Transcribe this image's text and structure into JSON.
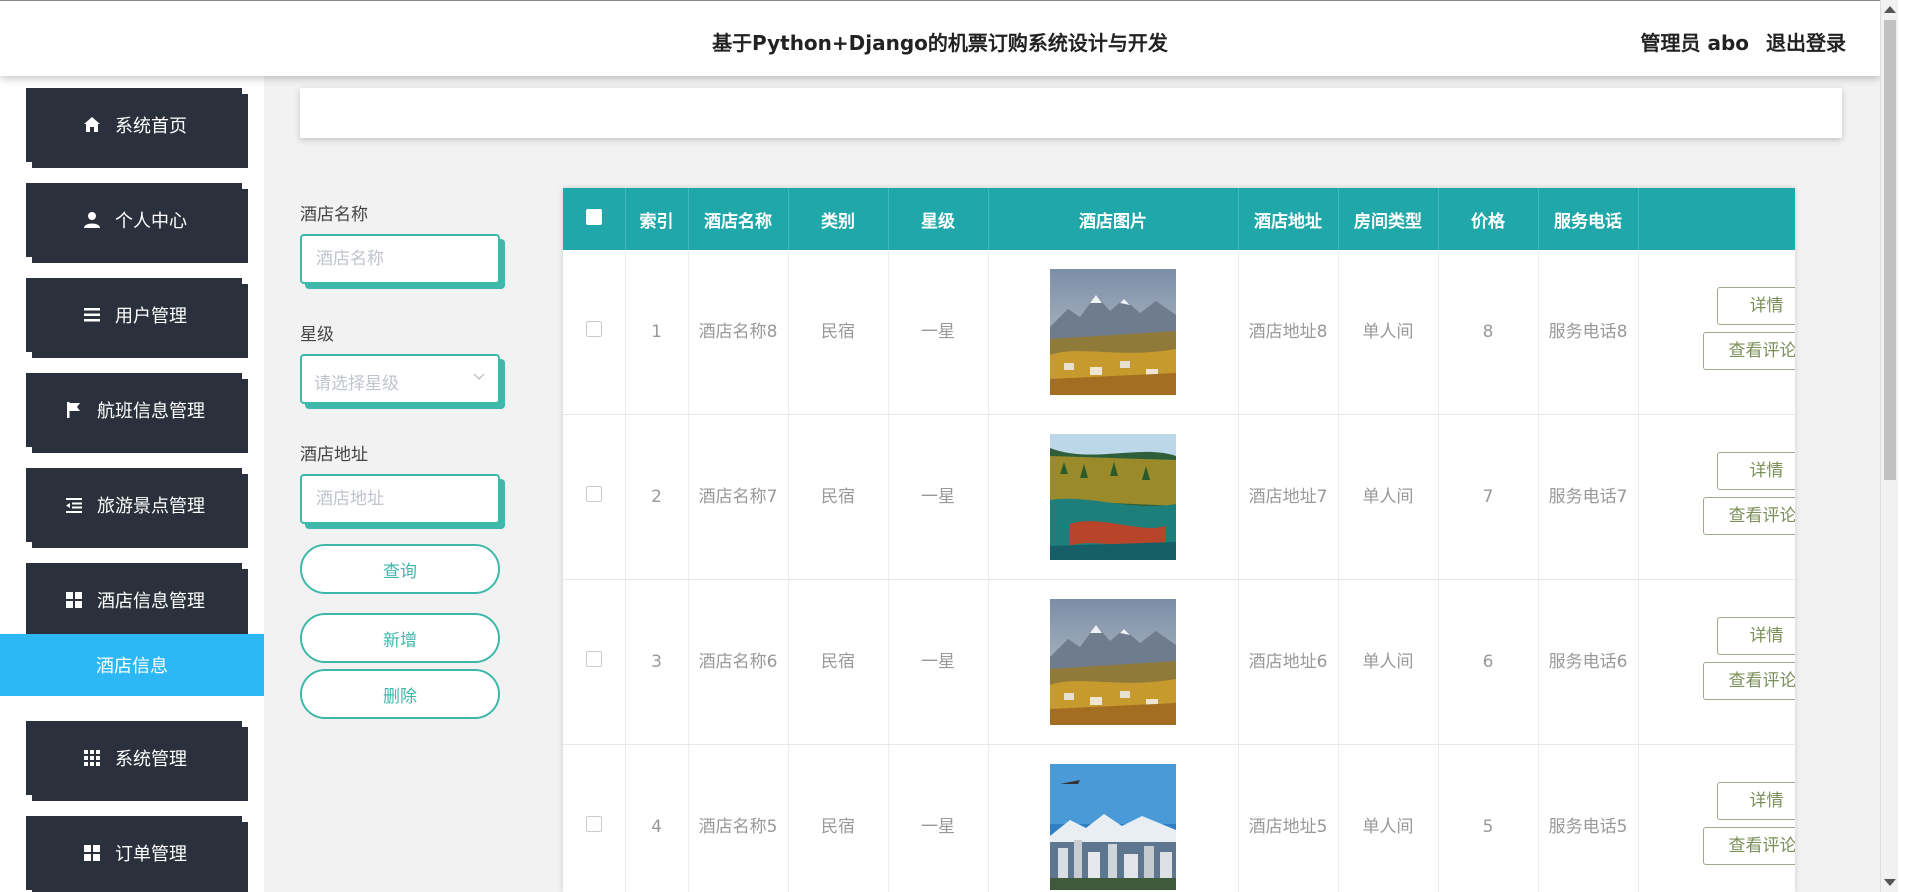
{
  "header": {
    "title": "基于Python+Django的机票订购系统设计与开发",
    "user": "管理员 abo",
    "logout": "退出登录"
  },
  "sidebar": {
    "items": [
      {
        "label": "系统首页",
        "icon": "home-icon"
      },
      {
        "label": "个人中心",
        "icon": "user-icon"
      },
      {
        "label": "用户管理",
        "icon": "list-icon"
      },
      {
        "label": "航班信息管理",
        "icon": "flag-icon"
      },
      {
        "label": "旅游景点管理",
        "icon": "indent-icon"
      },
      {
        "label": "酒店信息管理",
        "icon": "grid-icon"
      },
      {
        "label": "系统管理",
        "icon": "apps-icon"
      },
      {
        "label": "订单管理",
        "icon": "grid-icon"
      }
    ],
    "active_sub": "酒店信息"
  },
  "search": {
    "name_label": "酒店名称",
    "name_placeholder": "酒店名称",
    "star_label": "星级",
    "star_placeholder": "请选择星级",
    "addr_label": "酒店地址",
    "addr_placeholder": "酒店地址",
    "query": "查询",
    "add": "新增",
    "delete": "删除"
  },
  "table": {
    "columns": [
      "索引",
      "酒店名称",
      "类别",
      "星级",
      "酒店图片",
      "酒店地址",
      "房间类型",
      "价格",
      "服务电话"
    ],
    "detail_label": "详情",
    "review_label": "查看评论",
    "rows": [
      {
        "index": "1",
        "name": "酒店名称8",
        "type": "民宿",
        "star": "一星",
        "img": "mountain-village",
        "addr": "酒店地址8",
        "room": "单人间",
        "price": "8",
        "phone": "服务电话8"
      },
      {
        "index": "2",
        "name": "酒店名称7",
        "type": "民宿",
        "star": "一星",
        "img": "lake-forest",
        "addr": "酒店地址7",
        "room": "单人间",
        "price": "7",
        "phone": "服务电话7"
      },
      {
        "index": "3",
        "name": "酒店名称6",
        "type": "民宿",
        "star": "一星",
        "img": "mountain-village",
        "addr": "酒店地址6",
        "room": "单人间",
        "price": "6",
        "phone": "服务电话6"
      },
      {
        "index": "4",
        "name": "酒店名称5",
        "type": "民宿",
        "star": "一星",
        "img": "city-mountains",
        "addr": "酒店地址5",
        "room": "单人间",
        "price": "5",
        "phone": "服务电话5"
      }
    ]
  },
  "colors": {
    "accent": "#3fb8ac",
    "table_header": "#1fa7a9",
    "sidebar": "#2b313c",
    "active": "#2db7f5"
  }
}
